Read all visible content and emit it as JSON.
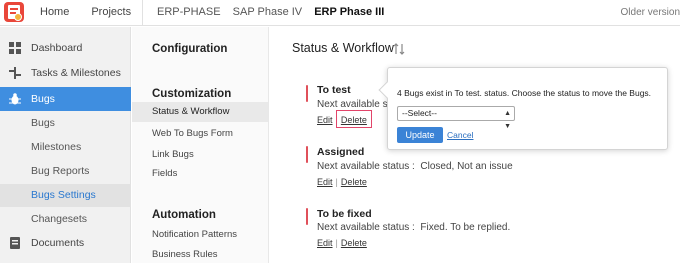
{
  "topbar": {
    "nav": [
      "Home",
      "Projects"
    ],
    "projects": [
      "ERP-PHASE",
      "SAP Phase IV",
      "ERP Phase III"
    ],
    "right_text": "Older version"
  },
  "sidebar": {
    "items": [
      {
        "label": "Dashboard",
        "icon": "grid-icon"
      },
      {
        "label": "Tasks & Milestones",
        "icon": "tasks-icon"
      },
      {
        "label": "Bugs",
        "icon": "bug-icon"
      }
    ],
    "sub_items": [
      "Bugs",
      "Milestones",
      "Bug Reports",
      "Bugs Settings",
      "Changesets"
    ],
    "bottom_item": {
      "label": "Documents",
      "icon": "documents-icon"
    },
    "accent": "#3f8ee0"
  },
  "settings": {
    "sections": [
      {
        "title": "Configuration",
        "links": []
      },
      {
        "title": "Customization",
        "links": [
          "Status & Workflow",
          "Web To Bugs Form",
          "Link Bugs",
          "Fields"
        ]
      },
      {
        "title": "Automation",
        "links": [
          "Notification Patterns",
          "Business Rules"
        ]
      }
    ]
  },
  "main": {
    "title": "Status & Workflow",
    "next_label": "Next available status :",
    "edit_label": "Edit",
    "delete_label": "Delete",
    "statuses": [
      {
        "name": "To test",
        "next": "Next available status",
        "color": "#e0505a"
      },
      {
        "name": "Assigned",
        "next": "Closed, Not an issue",
        "color": "#e0505a"
      },
      {
        "name": "To be fixed",
        "next": "Fixed. To be replied.",
        "color": "#e0505a"
      }
    ]
  },
  "popover": {
    "message": "4 Bugs exist in To test. status. Choose the status to move the Bugs.",
    "select_value": "--Select--",
    "update_label": "Update",
    "cancel_label": "Cancel"
  }
}
